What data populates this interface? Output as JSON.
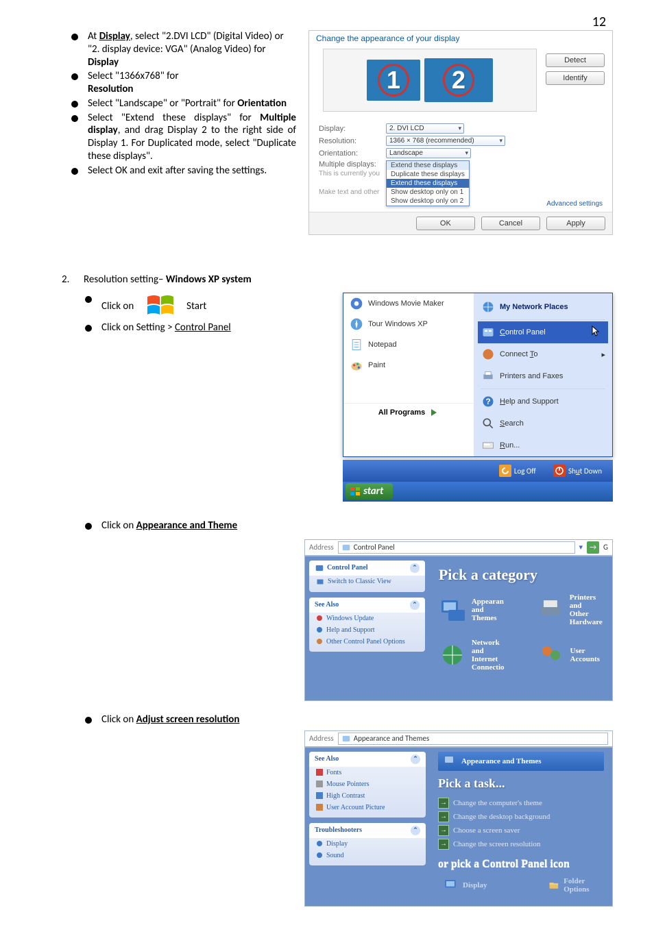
{
  "page_number": "12",
  "bullets_top": [
    {
      "pre": "At ",
      "em": "Display",
      "post": ", select \"2.DVI LCD\" (Digital Video) or \"2. display device: VGA\" (Analog Video) for ",
      "tail": "Display"
    },
    {
      "pre": "Select \"1366x768\" for ",
      "em2": "Resolution"
    },
    {
      "pre": "Select \"Landscape\" or \"Portrait\" for ",
      "em2": "Orientation"
    },
    {
      "pre": "Select \"Extend these displays\" for ",
      "em2": "Multiple display",
      "post": ", and drag Display 2 to the right side of Display 1. For Duplicated mode, select \"Duplicate these displays\"."
    },
    {
      "pre": "Select OK and exit after saving the settings."
    }
  ],
  "win7": {
    "title": "Change the appearance of your display",
    "mon1": "1",
    "mon2": "2",
    "detect": "Detect",
    "identify": "Identify",
    "labels": {
      "display": "Display:",
      "resolution": "Resolution:",
      "orientation": "Orientation:",
      "multiple": "Multiple displays:",
      "currently": "This is currently you",
      "make": "Make text and other"
    },
    "sel_display": "2. DVI LCD",
    "sel_res": "1366 × 768 (recommended)",
    "sel_orient": "Landscape",
    "dd": [
      "Extend these displays",
      "Duplicate these displays",
      "Extend these displays",
      "Show desktop only on 1",
      "Show desktop only on 2"
    ],
    "advanced": "Advanced settings",
    "ok": "OK",
    "cancel": "Cancel",
    "apply": "Apply"
  },
  "section2_num": "2.",
  "section2_title_a": "Resolution  setting– ",
  "section2_title_b": "Windows XP system",
  "bullets_mid": {
    "b1a": "Click on",
    "b1b": "Start",
    "b2a": "Click on Setting > ",
    "b2b": "Control Panel"
  },
  "xp_menu": {
    "left": [
      "Windows Movie Maker",
      "Tour Windows XP",
      "Notepad",
      "Paint"
    ],
    "all": "All Programs",
    "right_title": "My Network Places",
    "right": [
      "Control Panel",
      "Connect To",
      "Printers and Faxes",
      "Help and Support",
      "Search",
      "Run..."
    ],
    "right_letters": [
      "C",
      "T"
    ],
    "logoff": "Log Off",
    "shutdown": "Shut Down",
    "start": "start"
  },
  "bullet_appearance_a": "Click on ",
  "bullet_appearance_b": "Appearance and Theme",
  "cp1": {
    "addr_label": "Address",
    "addr_path": "Control Panel",
    "side_title": "Control Panel",
    "switch": "Switch to Classic View",
    "see_also": "See Also",
    "see_links": [
      "Windows Update",
      "Help and Support",
      "Other Control Panel Options"
    ],
    "main_h": "Pick a category",
    "cat1": "Appearance and Themes",
    "cat2": "Printers and Other Hardware",
    "cat3": "Network and Internet Connection",
    "cat4": "User Accounts"
  },
  "bullet_adjust_a": "Click on ",
  "bullet_adjust_b": "Adjust screen resolution",
  "cp2": {
    "addr_label": "Address",
    "addr_path": "Appearance and Themes",
    "see_also": "See Also",
    "see_links": [
      "Fonts",
      "Mouse Pointers",
      "High Contrast",
      "User Account Picture"
    ],
    "trouble": "Troubleshooters",
    "tlinks": [
      "Display",
      "Sound"
    ],
    "bar_title": "Appearance and Themes",
    "task_h": "Pick a task...",
    "tasks": [
      "Change the computer's theme",
      "Change the desktop background",
      "Choose a screen saver",
      "Change the screen resolution"
    ],
    "or": "or pick a Control Panel icon",
    "icon1": "Display",
    "icon2": "Folder Options"
  }
}
